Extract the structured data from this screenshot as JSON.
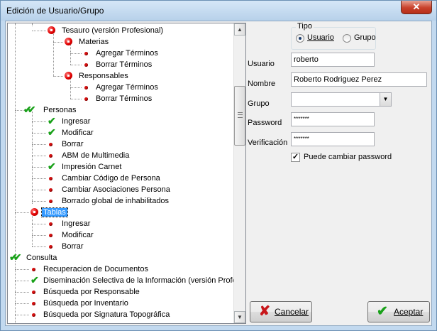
{
  "window": {
    "title": "Edición de Usuario/Grupo",
    "close_glyph": "✕"
  },
  "tree": {
    "items": [
      {
        "label": "Tesauro (versión Profesional)",
        "icon": "red-dot-big-icon"
      },
      {
        "label": "Materias",
        "icon": "red-dot-big-icon"
      },
      {
        "label": "Agregar Términos",
        "icon": "red-dot-small-icon"
      },
      {
        "label": "Borrar Términos",
        "icon": "red-dot-small-icon"
      },
      {
        "label": "Responsables",
        "icon": "red-dot-big-icon"
      },
      {
        "label": "Agregar Términos",
        "icon": "red-dot-small-icon"
      },
      {
        "label": "Borrar Términos",
        "icon": "red-dot-small-icon"
      },
      {
        "label": "Personas",
        "icon": "double-check-icon"
      },
      {
        "label": "Ingresar",
        "icon": "check-icon"
      },
      {
        "label": "Modificar",
        "icon": "check-icon"
      },
      {
        "label": "Borrar",
        "icon": "red-dot-small-icon"
      },
      {
        "label": "ABM de Multimedia",
        "icon": "red-dot-small-icon"
      },
      {
        "label": "Impresión Carnet",
        "icon": "check-icon"
      },
      {
        "label": "Cambiar Código de Persona",
        "icon": "red-dot-small-icon"
      },
      {
        "label": "Cambiar Asociaciones Persona",
        "icon": "red-dot-small-icon"
      },
      {
        "label": "Borrado global de inhabilitados",
        "icon": "red-dot-small-icon"
      },
      {
        "label": "Tablas",
        "icon": "red-dot-big-icon"
      },
      {
        "label": "Ingresar",
        "icon": "red-dot-small-icon"
      },
      {
        "label": "Modificar",
        "icon": "red-dot-small-icon"
      },
      {
        "label": "Borrar",
        "icon": "red-dot-small-icon"
      },
      {
        "label": "Consulta",
        "icon": "double-check-icon"
      },
      {
        "label": "Recuperacion de Documentos",
        "icon": "red-dot-small-icon"
      },
      {
        "label": "Diseminación Selectiva de la Información (versión Profes",
        "icon": "check-icon"
      },
      {
        "label": "Búsqueda por Responsable",
        "icon": "red-dot-small-icon"
      },
      {
        "label": "Búsqueda por Inventario",
        "icon": "red-dot-small-icon"
      },
      {
        "label": "Búsqueda por Signatura Topográfica",
        "icon": "red-dot-small-icon"
      }
    ],
    "selected_label": "Tablas"
  },
  "form": {
    "tipo": {
      "legend": "Tipo",
      "usuario_label": "Usuario",
      "grupo_label": "Grupo",
      "selected": "Usuario"
    },
    "usuario": {
      "label": "Usuario",
      "value": "roberto"
    },
    "nombre": {
      "label": "Nombre",
      "value": "Roberto Rodriguez Perez"
    },
    "grupo": {
      "label": "Grupo",
      "value": ""
    },
    "password": {
      "label": "Password",
      "value": "*******"
    },
    "verificacion": {
      "label": "Verificación",
      "value": "*******"
    },
    "puede_cambiar": {
      "label": "Puede cambiar password",
      "checked": true
    }
  },
  "buttons": {
    "cancel_label": "Cancelar",
    "accept_label": "Aceptar"
  },
  "colors": {
    "accent_check": "#19a119",
    "red_dot": "#d61010",
    "selection": "#3399ff"
  }
}
